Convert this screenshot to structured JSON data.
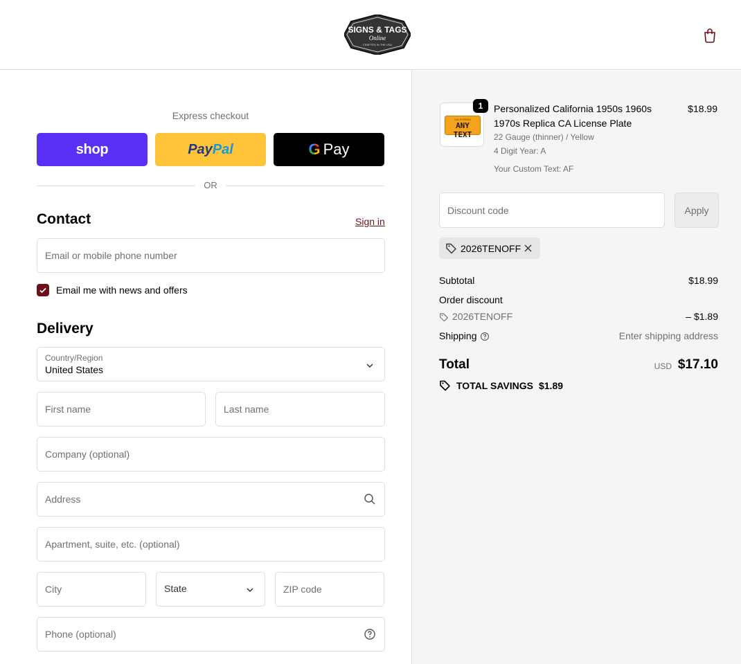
{
  "header": {
    "logo_line1": "SIGNS & TAGS",
    "logo_line2": "Online",
    "logo_line3": "CRAFTED IN THE USA",
    "cart_icon": "shopping-bag-icon"
  },
  "express": {
    "title": "Express checkout",
    "shop_label": "shop",
    "paypal_label_1": "Pay",
    "paypal_label_2": "Pal",
    "gpay_label": "Pay",
    "or_label": "OR"
  },
  "contact": {
    "title": "Contact",
    "sign_in": "Sign in",
    "email_placeholder": "Email or mobile phone number",
    "newsletter_label": "Email me with news and offers",
    "newsletter_checked": true
  },
  "delivery": {
    "title": "Delivery",
    "country_label": "Country/Region",
    "country_value": "United States",
    "first_name": "First name",
    "last_name": "Last name",
    "company": "Company (optional)",
    "address": "Address",
    "apartment": "Apartment, suite, etc. (optional)",
    "city": "City",
    "state": "State",
    "zip": "ZIP code",
    "phone": "Phone (optional)"
  },
  "summary": {
    "item": {
      "quantity": "1",
      "title": "Personalized California 1950s 1960s 1970s Replica CA License Plate",
      "price": "$18.99",
      "variant": "22 Gauge (thinner) / Yellow",
      "digit_year": "4 Digit Year: A",
      "custom_text": "Your Custom Text: AF",
      "plate_text": "ANY TEXT",
      "plate_top": "CALIFORNIA"
    },
    "discount_placeholder": "Discount code",
    "apply_label": "Apply",
    "applied_code": "2026TENOFF",
    "subtotal_label": "Subtotal",
    "subtotal_value": "$18.99",
    "order_discount_label": "Order discount",
    "discount_code": "2026TENOFF",
    "discount_value": "– $1.89",
    "shipping_label": "Shipping",
    "shipping_value": "Enter shipping address",
    "total_label": "Total",
    "currency": "USD",
    "total_value": "$17.10",
    "savings_label": "TOTAL SAVINGS",
    "savings_value": "$1.89"
  },
  "colors": {
    "accent": "#6b1218",
    "shop": "#5a31f4",
    "paypal": "#ffc439",
    "summary_bg": "#f5f5f5"
  }
}
